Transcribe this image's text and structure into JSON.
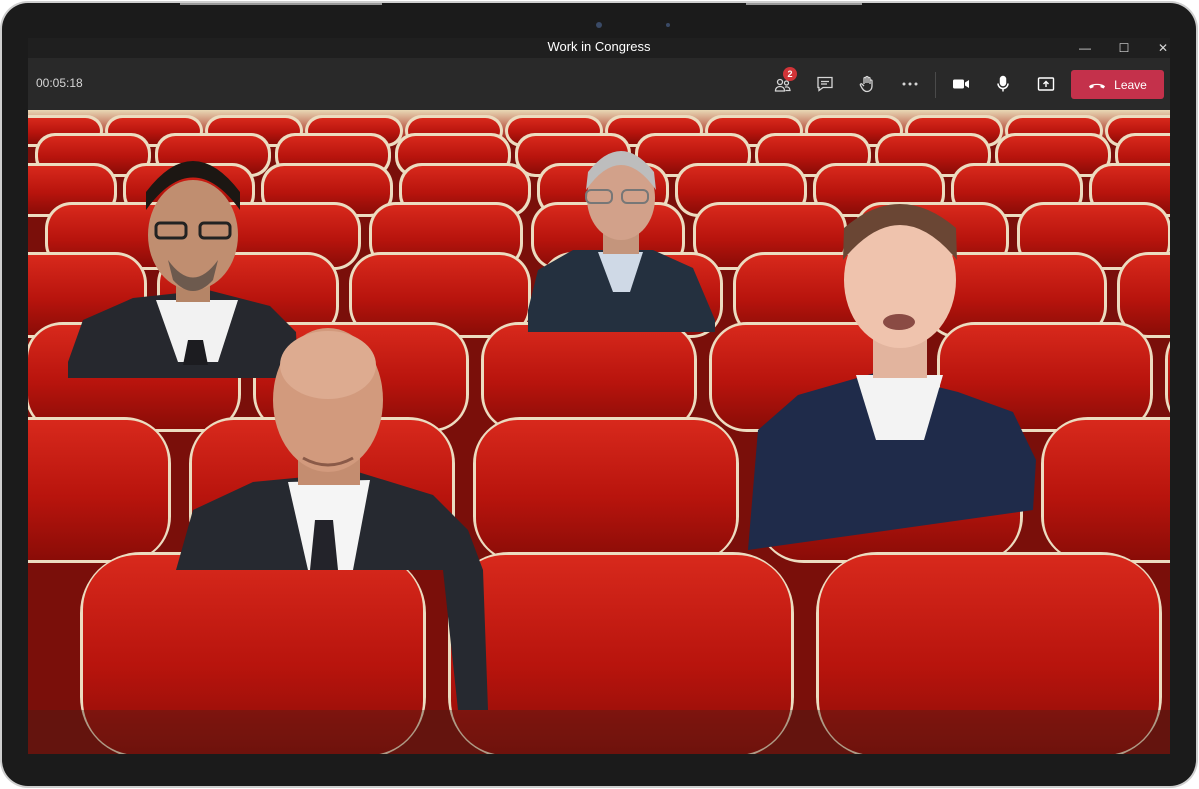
{
  "window": {
    "title": "Work in Congress"
  },
  "toolbar": {
    "timer": "00:05:18",
    "participants_badge": "2",
    "leave_label": "Leave"
  },
  "icons": {
    "minimize": "minimize-icon",
    "maximize": "maximize-icon",
    "close": "close-icon",
    "participants": "people-icon",
    "chat": "chat-icon",
    "raise_hand": "hand-icon",
    "more": "more-icon",
    "camera": "video-camera-icon",
    "mic": "microphone-icon",
    "share": "share-screen-icon",
    "leave": "phone-hangup-icon"
  },
  "colors": {
    "leave_button": "#c4314b",
    "badge": "#d13438",
    "toolbar_bg": "#292929",
    "seat_red": "#c3180f"
  }
}
